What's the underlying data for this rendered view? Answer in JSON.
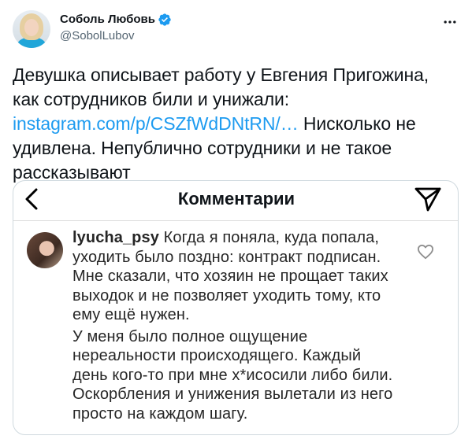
{
  "author": {
    "display_name": "Соболь Любовь",
    "handle": "@SobolLubov",
    "verified_icon": "verified-badge-icon",
    "verified_color": "#1d9bf0"
  },
  "tweet": {
    "text_before_link": "Девушка описывает работу у Евгения Пригожина, как сотрудников били и унижали: ",
    "link_text": "instagram.com/p/CSZfWdDNtRN/…",
    "text_after_link": " Нисколько не удивлена. Непублично сотрудники и не такое рассказывают",
    "link_color": "#1d9bf0"
  },
  "media": {
    "header_title": "Комментарии",
    "back_icon": "chevron-left-icon",
    "send_icon": "paper-plane-icon",
    "comment": {
      "username": "lyucha_psy",
      "paragraph_1": "Когда я поняла, куда попала, уходить было поздно: контракт подписан. Мне сказали, что хозяин не прощает таких выходок и не позволяет уходить тому, кто ему ещё нужен.",
      "paragraph_2": "У меня было полное ощущение нереальности происходящего. Каждый день кого-то при мне х*исосили либо били. Оскорбления и унижения вылетали из него просто на каждом шагу.",
      "like_icon": "heart-outline-icon"
    }
  }
}
